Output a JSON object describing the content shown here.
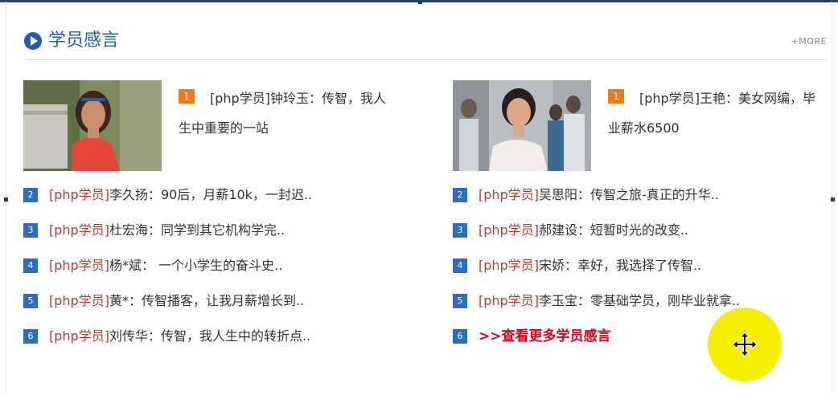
{
  "header": {
    "title": "学员感言",
    "more_label": "+MORE"
  },
  "featured": [
    {
      "rank": "1",
      "text": "[php学员]钟玲玉：传智，我人生中重要的一站"
    },
    {
      "rank": "1",
      "text": "[php学员]王艳：美女网编，毕业薪水6500"
    }
  ],
  "left_list": [
    {
      "rank": "2",
      "tag": "[php学员]",
      "text": "李久扬：90后，月薪10k，一封迟.."
    },
    {
      "rank": "3",
      "tag": "[php学员]",
      "text": "杜宏海：同学到其它机构学完.."
    },
    {
      "rank": "4",
      "tag": "[php学员]",
      "text": "杨*斌： 一个小学生的奋斗史.."
    },
    {
      "rank": "5",
      "tag": "[php学员]",
      "text": "黄*：传智播客，让我月薪增长到.."
    },
    {
      "rank": "6",
      "tag": "[php学员]",
      "text": "刘传华：传智，我人生中的转折点.."
    }
  ],
  "right_list": [
    {
      "rank": "2",
      "tag": "[php学员]",
      "text": "吴思阳：传智之旅-真正的升华.."
    },
    {
      "rank": "3",
      "tag": "[php学员]",
      "text": "郝建设：短暂时光的改变.."
    },
    {
      "rank": "4",
      "tag": "[php学员]",
      "text": "宋娇：幸好，我选择了传智.."
    },
    {
      "rank": "5",
      "tag": "[php学员]",
      "text": "李玉宝：零基础学员，刚毕业就拿.."
    }
  ],
  "more_testimonials": {
    "rank": "6",
    "label": ">>查看更多学员感言"
  },
  "colors": {
    "accent_blue": "#1f5db8",
    "tag_red": "#c0392b",
    "link_red": "#e0001b",
    "badge_orange": "#f07a1a",
    "cursor_yellow": "#f7ef00"
  },
  "icons": {
    "header": "play-circle-icon",
    "cursor": "move-cursor-icon"
  }
}
